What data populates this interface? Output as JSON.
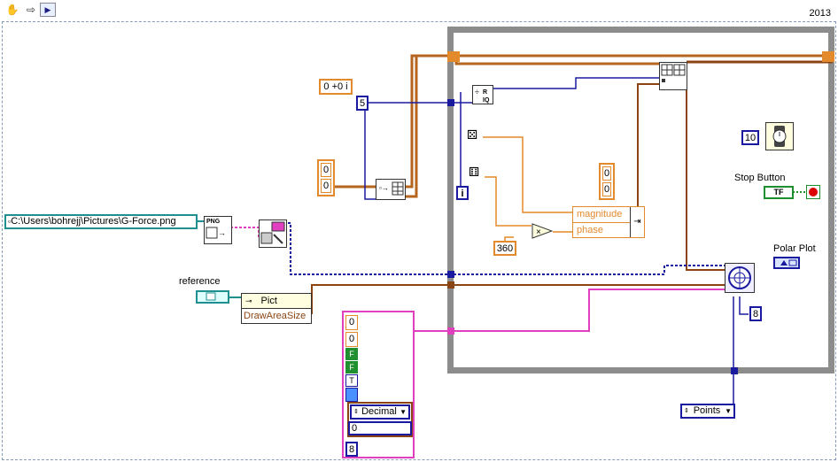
{
  "toolbar": {
    "run_icon": "hand-icon",
    "version": "2013"
  },
  "constants": {
    "complex": "0 +0 i",
    "five": "5",
    "ten": "10",
    "three_sixty": "360",
    "eight": "8",
    "zero": "0",
    "i_terminal": "i"
  },
  "path": {
    "value": "C:\\Users\\bohrejj\\Pictures\\G-Force.png"
  },
  "labels": {
    "stop_button": "Stop Button",
    "polar_plot": "Polar Plot",
    "reference": "reference",
    "pict": "Pict",
    "draw_area_size": "DrawAreaSize",
    "magnitude": "magnitude",
    "phase": "phase",
    "decimal": "Decimal",
    "points": "Points",
    "tf": "TF",
    "png": "PNG"
  },
  "cluster": {
    "items": [
      "0",
      "0",
      "F",
      "F",
      "T",
      "",
      "0",
      "8"
    ]
  },
  "colors": {
    "orange": "#e38a2c",
    "blue": "#1a1aa0",
    "pink": "#e040c0",
    "green": "#1f8f2f",
    "gray": "#8c8c8c",
    "brown": "#8b4513"
  }
}
